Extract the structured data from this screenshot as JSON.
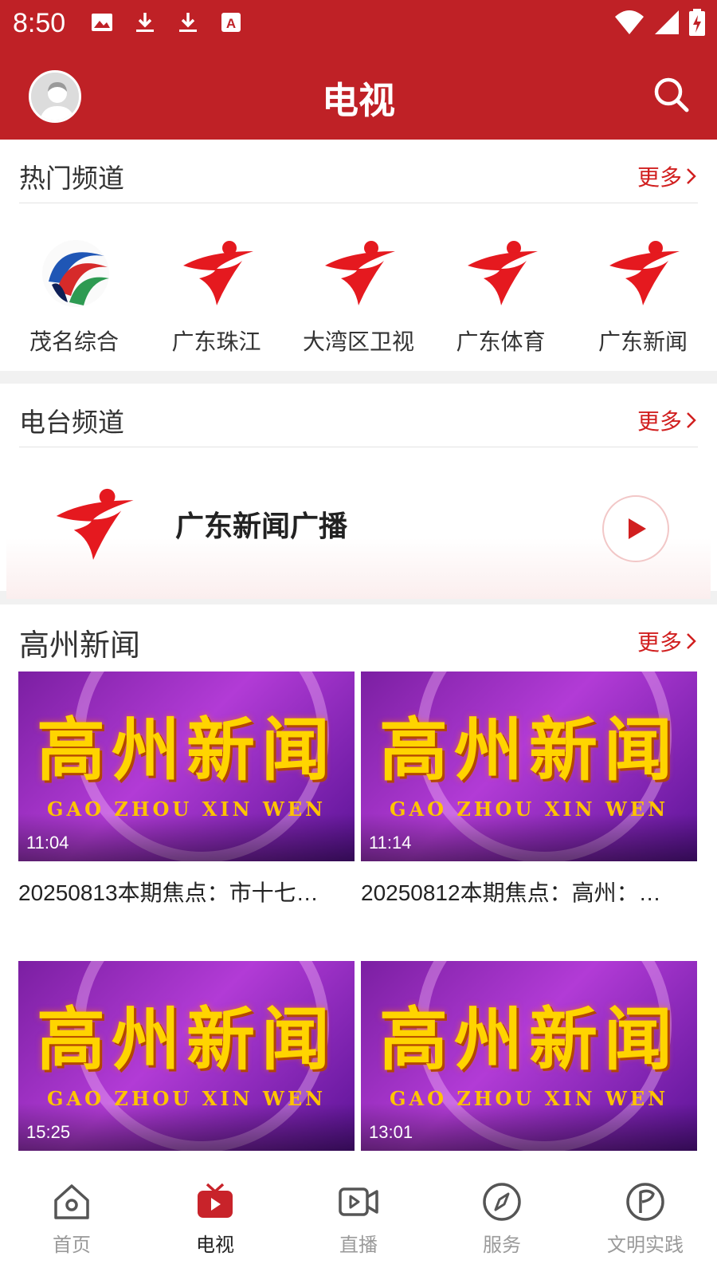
{
  "status": {
    "time": "8:50"
  },
  "header": {
    "title": "电视"
  },
  "hot": {
    "title": "热门频道",
    "more": "更多",
    "channels": [
      {
        "name": "茂名综合",
        "icon": "maoming-logo-icon"
      },
      {
        "name": "广东珠江",
        "icon": "gdtv-logo-icon"
      },
      {
        "name": "大湾区卫视",
        "icon": "gdtv-logo-icon"
      },
      {
        "name": "广东体育",
        "icon": "gdtv-logo-icon"
      },
      {
        "name": "广东新闻",
        "icon": "gdtv-logo-icon"
      }
    ]
  },
  "radio": {
    "title": "电台频道",
    "more": "更多",
    "station": "广东新闻广播"
  },
  "news": {
    "title": "高州新闻",
    "more": "更多",
    "thumb_title": "高州新闻",
    "thumb_pinyin": "GAO ZHOU XIN WEN",
    "items": [
      {
        "duration": "11:04",
        "caption": "20250813本期焦点：市十七…"
      },
      {
        "duration": "11:14",
        "caption": "20250812本期焦点：高州：…"
      },
      {
        "duration": "15:25",
        "caption": ""
      },
      {
        "duration": "13:01",
        "caption": ""
      }
    ]
  },
  "tabs": [
    {
      "label": "首页",
      "icon": "home-icon",
      "active": false
    },
    {
      "label": "电视",
      "icon": "tv-icon",
      "active": true
    },
    {
      "label": "直播",
      "icon": "live-video-icon",
      "active": false
    },
    {
      "label": "服务",
      "icon": "compass-icon",
      "active": false
    },
    {
      "label": "文明实践",
      "icon": "flag-circle-icon",
      "active": false
    }
  ],
  "colors": {
    "brand": "#bf2126",
    "accent": "#d11f1f"
  }
}
